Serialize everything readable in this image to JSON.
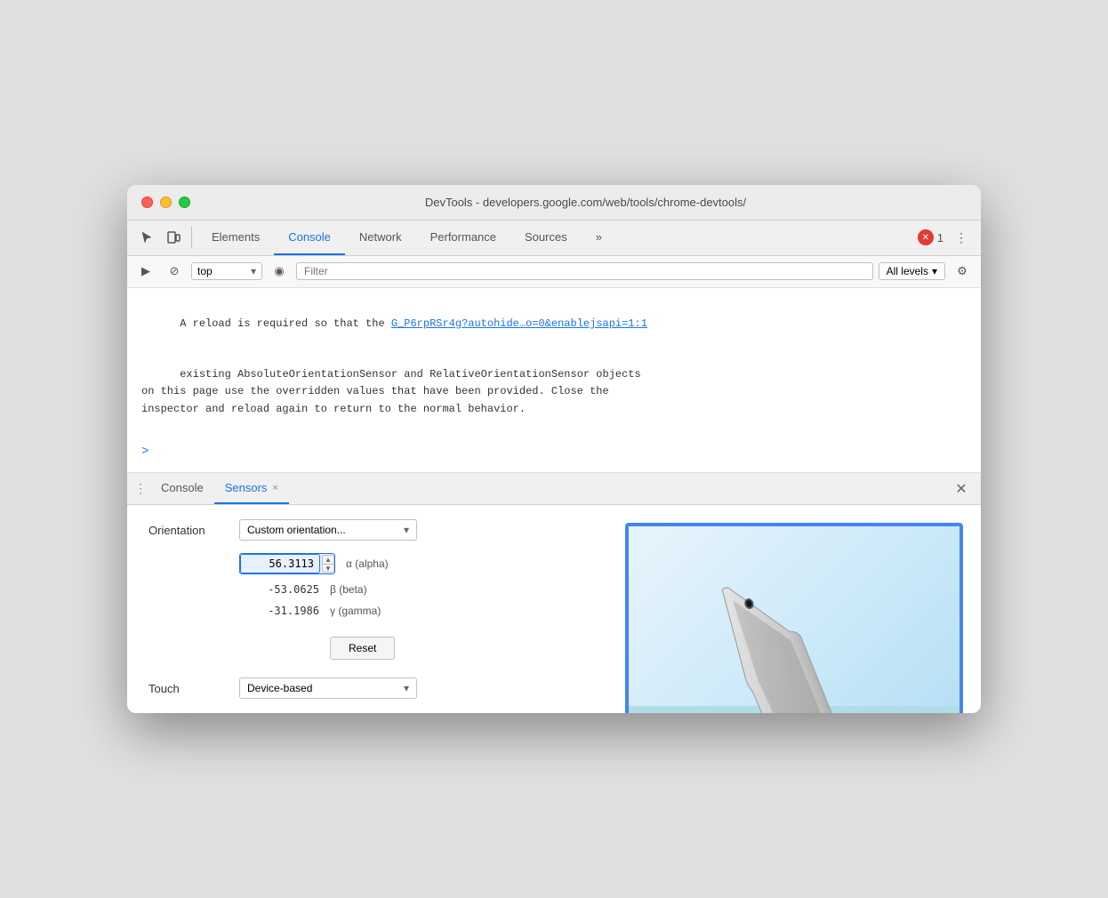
{
  "window": {
    "title": "DevTools - developers.google.com/web/tools/chrome-devtools/"
  },
  "toolbar": {
    "tabs": [
      {
        "id": "elements",
        "label": "Elements",
        "active": false
      },
      {
        "id": "console",
        "label": "Console",
        "active": true
      },
      {
        "id": "network",
        "label": "Network",
        "active": false
      },
      {
        "id": "performance",
        "label": "Performance",
        "active": false
      },
      {
        "id": "sources",
        "label": "Sources",
        "active": false
      },
      {
        "id": "more",
        "label": "»",
        "active": false
      }
    ],
    "error_count": "1",
    "more_icon": "⋮"
  },
  "console_toolbar": {
    "context": "top",
    "filter_placeholder": "Filter",
    "levels": "All levels"
  },
  "console_message": {
    "text_line1": "A reload is required so that the ",
    "link_text": "G_P6rpRSr4g?autohide…o=0&enablejsapi=1:1",
    "text_line2": "existing AbsoluteOrientationSensor and RelativeOrientationSensor objects\non this page use the overridden values that have been provided. Close the\ninspector and reload again to return to the normal behavior.",
    "prompt": ">"
  },
  "bottom_panel": {
    "tabs": [
      {
        "id": "console",
        "label": "Console",
        "active": false,
        "closeable": false
      },
      {
        "id": "sensors",
        "label": "Sensors",
        "active": true,
        "closeable": true
      }
    ]
  },
  "sensors": {
    "orientation_label": "Orientation",
    "dropdown_value": "Custom orientation...",
    "alpha_value": "56.3113",
    "alpha_label": "α (alpha)",
    "beta_value": "-53.0625",
    "beta_label": "β (beta)",
    "gamma_value": "-31.1986",
    "gamma_label": "γ (gamma)",
    "reset_label": "Reset",
    "touch_label": "Touch",
    "touch_dropdown": "Device-based"
  },
  "icons": {
    "cursor": "↖",
    "device": "⊡",
    "play": "▶",
    "block": "⊘",
    "eye": "◉",
    "gear": "⚙",
    "close": "✕",
    "chevron_down": "▾",
    "more_vert": "⋮"
  }
}
